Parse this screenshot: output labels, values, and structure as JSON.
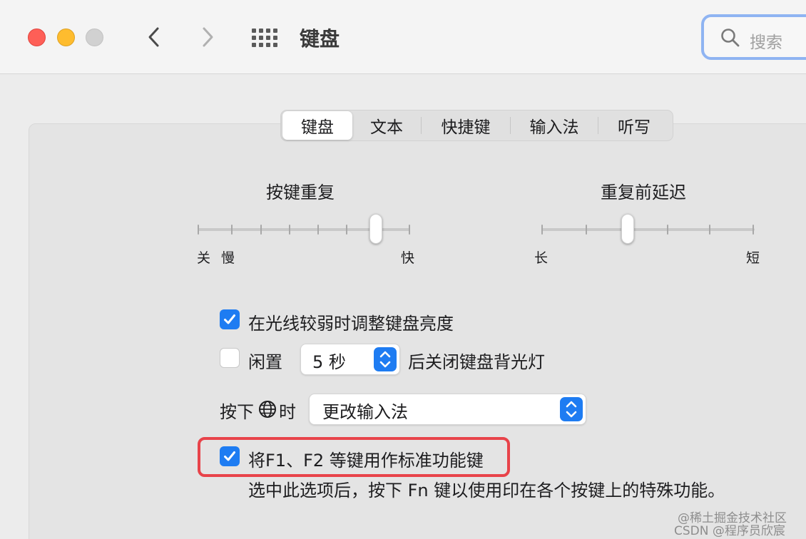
{
  "window": {
    "title": "键盘",
    "search_placeholder": "搜索"
  },
  "tabs": [
    "键盘",
    "文本",
    "快捷键",
    "输入法",
    "听写"
  ],
  "active_tab": 0,
  "key_repeat": {
    "title": "按键重复",
    "label_off": "关",
    "label_slow": "慢",
    "label_fast": "快",
    "level_fraction": 0.83
  },
  "delay_until_repeat": {
    "title": "重复前延迟",
    "label_long": "长",
    "label_short": "短",
    "level_fraction": 0.4
  },
  "options": {
    "adjust_brightness": {
      "label": "在光线较弱时调整键盘亮度",
      "checked": true
    },
    "backlight_off": {
      "prefix": "闲置",
      "popup_value": "5 秒",
      "suffix": "后关闭键盘背光灯",
      "checked": false
    },
    "globe_key": {
      "prefix": "按下",
      "suffix": "时",
      "popup_value": "更改输入法"
    },
    "fn_keys": {
      "label": "将F1、F2 等键用作标准功能键",
      "checked": true,
      "description": "选中此选项后，按下 Fn 键以使用印在各个按键上的特殊功能。"
    }
  },
  "watermark": {
    "line1": "@稀土掘金技术社区",
    "line2": "CSDN @程序员欣宸"
  },
  "colors": {
    "accent": "#1e7cf2",
    "highlight_box": "#e8434a",
    "search_focus": "#8fb4f2"
  }
}
